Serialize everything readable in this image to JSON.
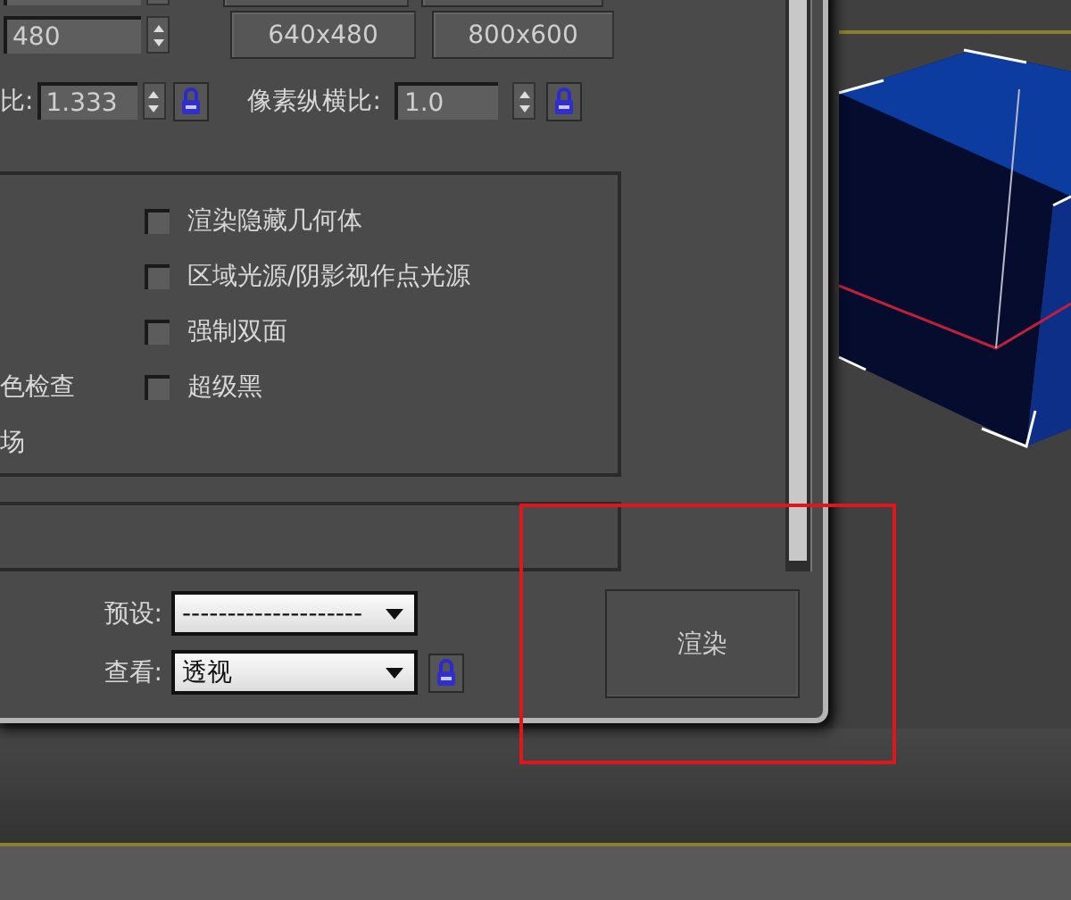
{
  "size": {
    "height_value": "480",
    "presets": [
      "640x480",
      "800x600"
    ]
  },
  "aspect": {
    "image_label": "比:",
    "image_value": "1.333",
    "pixel_label": "像素纵横比:",
    "pixel_value": "1.0"
  },
  "options_left": [
    "色检查",
    "场"
  ],
  "options": [
    {
      "label": "渲染隐藏几何体",
      "checked": false
    },
    {
      "label": "区域光源/阴影视作点光源",
      "checked": false
    },
    {
      "label": "强制双面",
      "checked": false
    },
    {
      "label": "超级黑",
      "checked": false
    }
  ],
  "footer": {
    "preset_label": "预设:",
    "preset_value": "--------------------",
    "view_label": "查看:",
    "view_value": "透视",
    "render_button": "渲染"
  }
}
